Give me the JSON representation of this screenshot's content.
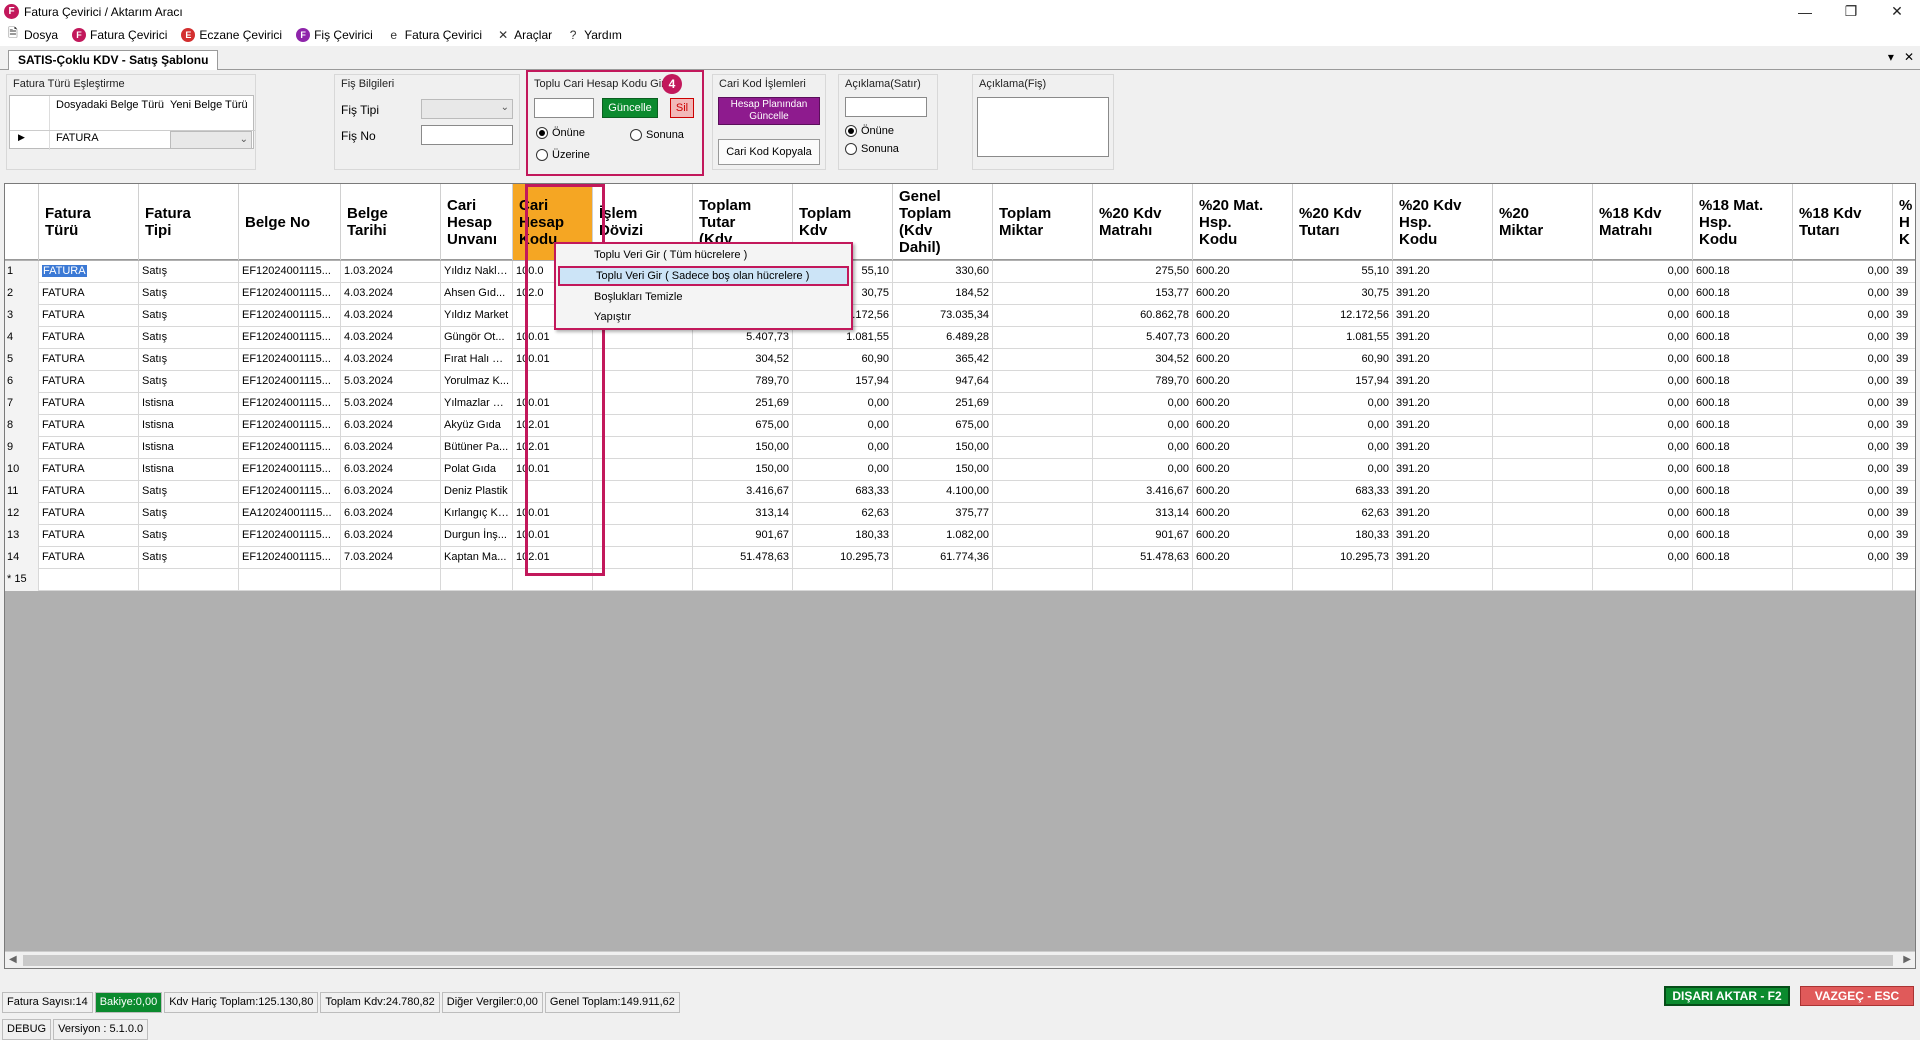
{
  "window": {
    "title": "Fatura Çevirici / Aktarım Aracı",
    "logo": "F"
  },
  "menu": [
    {
      "label": "Dosya",
      "icon": "document-icon",
      "glyph": "🗎",
      "cls": "plain"
    },
    {
      "label": "Fatura Çevirici",
      "icon": "fatura-icon",
      "glyph": "F",
      "cls": "pink"
    },
    {
      "label": "Eczane Çevirici",
      "icon": "eczane-icon",
      "glyph": "E",
      "cls": "red"
    },
    {
      "label": "Fiş Çevirici",
      "icon": "fis-icon",
      "glyph": "F",
      "cls": "purple"
    },
    {
      "label": "Fatura Çevirici",
      "icon": "e-fatura-icon",
      "glyph": "e",
      "cls": "plain"
    },
    {
      "label": "Araçlar",
      "icon": "tools-icon",
      "glyph": "✕",
      "cls": "plain"
    },
    {
      "label": "Yardım",
      "icon": "help-icon",
      "glyph": "?",
      "cls": "plain"
    }
  ],
  "tab": {
    "label": "SATIS-Çoklu KDV - Satış Şablonu"
  },
  "mapping": {
    "title": "Fatura Türü Eşleştirme",
    "col1": "Dosyadaki Belge Türü",
    "col2": "Yeni Belge Türü",
    "row_value": "FATURA"
  },
  "fis": {
    "title": "Fiş Bilgileri",
    "tipi_label": "Fiş Tipi",
    "no_label": "Fiş No"
  },
  "toplu": {
    "title": "Toplu Cari Hesap Kodu Gir",
    "badge": "4",
    "update": "Güncelle",
    "delete": "Sil",
    "opt1": "Önüne",
    "opt2": "Sonuna",
    "opt3": "Üzerine"
  },
  "cari": {
    "title": "Cari Kod İşlemleri",
    "plan_btn": "Hesap Planından Güncelle",
    "copy_btn": "Cari Kod Kopyala"
  },
  "aciklama_satir": {
    "title": "Açıklama(Satır)",
    "opt1": "Önüne",
    "opt2": "Sonuna"
  },
  "aciklama_fis": {
    "title": "Açıklama(Fiş)"
  },
  "columns": [
    "Fatura\nTürü",
    "Fatura\nTipi",
    "Belge No",
    "Belge\nTarihi",
    "Cari\nHesap\nUnvanı",
    "Cari\nHesap\nKodu",
    "İşlem\nDövizi",
    "Toplam\nTutar\n(Kdv",
    "Toplam\nKdv",
    "Genel\nToplam\n(Kdv\nDahil)",
    "Toplam\nMiktar",
    "%20 Kdv\nMatrahı",
    "%20 Mat.\nHsp.\nKodu",
    "%20 Kdv\nTutarı",
    "%20 Kdv\nHsp.\nKodu",
    "%20\nMiktar",
    "%18 Kdv\nMatrahı",
    "%18 Mat.\nHsp.\nKodu",
    "%18 Kdv\nTutarı",
    "%\nH\nK"
  ],
  "rows": [
    [
      "1",
      "FATURA",
      "Satış",
      "EF12024001115...",
      "1.03.2024",
      "Yıldız Nakliyat",
      "100.0",
      "",
      "",
      "55,10",
      "330,60",
      "",
      "275,50",
      "600.20",
      "55,10",
      "391.20",
      "",
      "0,00",
      "600.18",
      "0,00",
      "39"
    ],
    [
      "2",
      "FATURA",
      "Satış",
      "EF12024001115...",
      "4.03.2024",
      "Ahsen Gıd...",
      "102.0",
      "",
      "",
      "30,75",
      "184,52",
      "",
      "153,77",
      "600.20",
      "30,75",
      "391.20",
      "",
      "0,00",
      "600.18",
      "0,00",
      "39"
    ],
    [
      "3",
      "FATURA",
      "Satış",
      "EF12024001115...",
      "4.03.2024",
      "Yıldız Market",
      "",
      "",
      "",
      "2.172,56",
      "73.035,34",
      "",
      "60.862,78",
      "600.20",
      "12.172,56",
      "391.20",
      "",
      "0,00",
      "600.18",
      "0,00",
      "39"
    ],
    [
      "4",
      "FATURA",
      "Satış",
      "EF12024001115...",
      "4.03.2024",
      "Güngör Ot...",
      "100.01",
      "",
      "5.407,73",
      "1.081,55",
      "6.489,28",
      "",
      "5.407,73",
      "600.20",
      "1.081,55",
      "391.20",
      "",
      "0,00",
      "600.18",
      "0,00",
      "39"
    ],
    [
      "5",
      "FATURA",
      "Satış",
      "EF12024001115...",
      "4.03.2024",
      "Fırat Halı Ti...",
      "100.01",
      "",
      "304,52",
      "60,90",
      "365,42",
      "",
      "304,52",
      "600.20",
      "60,90",
      "391.20",
      "",
      "0,00",
      "600.18",
      "0,00",
      "39"
    ],
    [
      "6",
      "FATURA",
      "Satış",
      "EF12024001115...",
      "5.03.2024",
      "Yorulmaz K...",
      "",
      "",
      "789,70",
      "157,94",
      "947,64",
      "",
      "789,70",
      "600.20",
      "157,94",
      "391.20",
      "",
      "0,00",
      "600.18",
      "0,00",
      "39"
    ],
    [
      "7",
      "FATURA",
      "Istisna",
      "EF12024001115...",
      "5.03.2024",
      "Yılmazlar Ti...",
      "100.01",
      "",
      "251,69",
      "0,00",
      "251,69",
      "",
      "0,00",
      "600.20",
      "0,00",
      "391.20",
      "",
      "0,00",
      "600.18",
      "0,00",
      "39"
    ],
    [
      "8",
      "FATURA",
      "Istisna",
      "EF12024001115...",
      "6.03.2024",
      "Akyüz Gıda",
      "102.01",
      "",
      "675,00",
      "0,00",
      "675,00",
      "",
      "0,00",
      "600.20",
      "0,00",
      "391.20",
      "",
      "0,00",
      "600.18",
      "0,00",
      "39"
    ],
    [
      "9",
      "FATURA",
      "Istisna",
      "EF12024001115...",
      "6.03.2024",
      "Bütüner Pa...",
      "102.01",
      "",
      "150,00",
      "0,00",
      "150,00",
      "",
      "0,00",
      "600.20",
      "0,00",
      "391.20",
      "",
      "0,00",
      "600.18",
      "0,00",
      "39"
    ],
    [
      "10",
      "FATURA",
      "Istisna",
      "EF12024001115...",
      "6.03.2024",
      "Polat Gıda",
      "100.01",
      "",
      "150,00",
      "0,00",
      "150,00",
      "",
      "0,00",
      "600.20",
      "0,00",
      "391.20",
      "",
      "0,00",
      "600.18",
      "0,00",
      "39"
    ],
    [
      "11",
      "FATURA",
      "Satış",
      "EF12024001115...",
      "6.03.2024",
      "Deniz Plastik",
      "",
      "",
      "3.416,67",
      "683,33",
      "4.100,00",
      "",
      "3.416,67",
      "600.20",
      "683,33",
      "391.20",
      "",
      "0,00",
      "600.18",
      "0,00",
      "39"
    ],
    [
      "12",
      "FATURA",
      "Satış",
      "EA12024001115...",
      "6.03.2024",
      "Kırlangıç Ki...",
      "100.01",
      "",
      "313,14",
      "62,63",
      "375,77",
      "",
      "313,14",
      "600.20",
      "62,63",
      "391.20",
      "",
      "0,00",
      "600.18",
      "0,00",
      "39"
    ],
    [
      "13",
      "FATURA",
      "Satış",
      "EF12024001115...",
      "6.03.2024",
      "Durgun İnş...",
      "100.01",
      "",
      "901,67",
      "180,33",
      "1.082,00",
      "",
      "901,67",
      "600.20",
      "180,33",
      "391.20",
      "",
      "0,00",
      "600.18",
      "0,00",
      "39"
    ],
    [
      "14",
      "FATURA",
      "Satış",
      "EF12024001115...",
      "7.03.2024",
      "Kaptan Ma...",
      "102.01",
      "",
      "51.478,63",
      "10.295,73",
      "61.774,36",
      "",
      "51.478,63",
      "600.20",
      "10.295,73",
      "391.20",
      "",
      "0,00",
      "600.18",
      "0,00",
      "39"
    ],
    [
      "* 15",
      "",
      "",
      "",
      "",
      "",
      "",
      "",
      "",
      "",
      "",
      "",
      "",
      "",
      "",
      "",
      "",
      "",
      "",
      "",
      ""
    ]
  ],
  "context_menu": [
    "Toplu Veri Gir ( Tüm hücrelere )",
    "Toplu Veri Gir ( Sadece boş olan hücrelere )",
    "Boşlukları Temizle",
    "Yapıştır"
  ],
  "status": {
    "count": "Fatura Sayısı:14",
    "bakiye": "Bakiye:0,00",
    "kdv_haric": "Kdv Hariç Toplam:125.130,80",
    "kdv": "Toplam Kdv:24.780,82",
    "diger": "Diğer Vergiler:0,00",
    "genel": "Genel Toplam:149.911,62",
    "export": "DIŞARI AKTAR - F2",
    "cancel": "VAZGEÇ - ESC"
  },
  "version": {
    "mode": "DEBUG",
    "version": "Versiyon : 5.1.0.0"
  },
  "colors": {
    "accent": "#c2185b",
    "green": "#0b8a2e",
    "purple": "#8e1b8e",
    "highlight": "#f5a623",
    "cancel": "#e05a5a"
  }
}
